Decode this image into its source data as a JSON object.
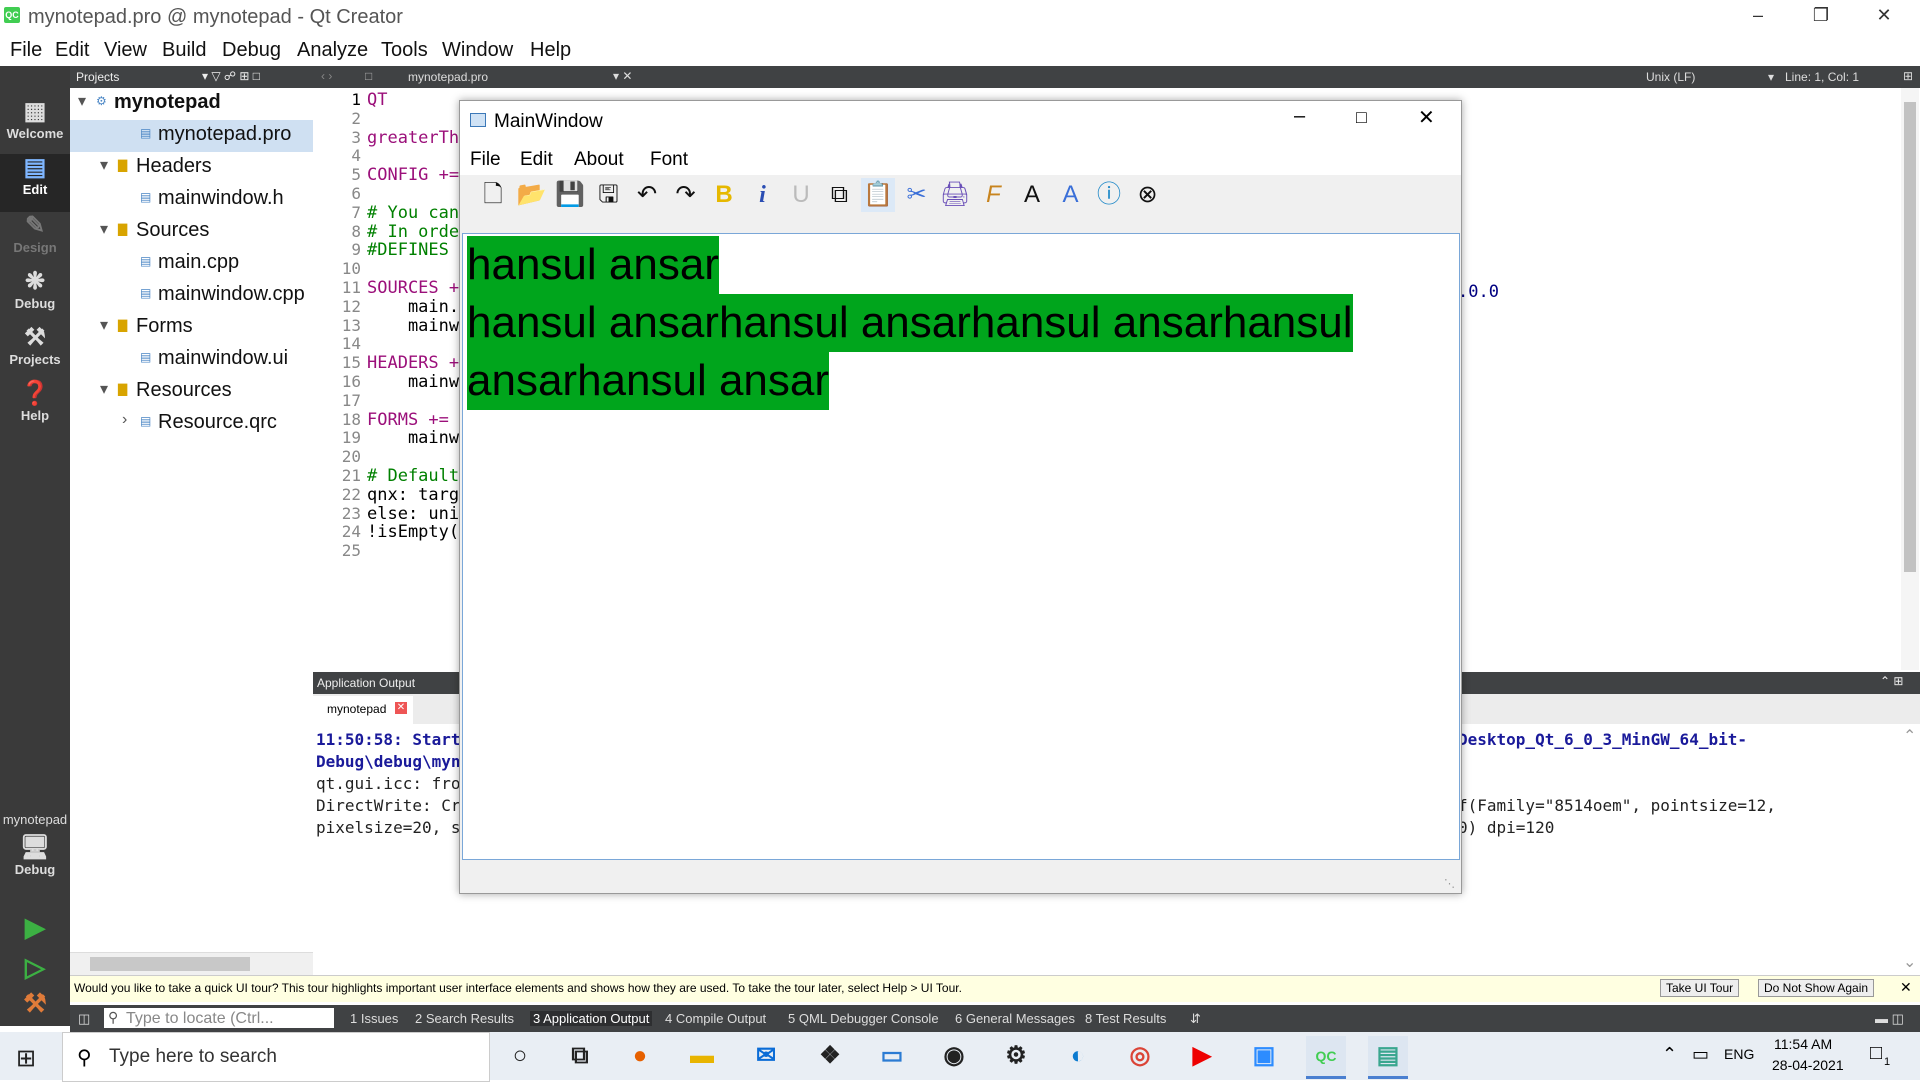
{
  "window": {
    "title": "mynotepad.pro @ mynotepad - Qt Creator",
    "logo": "QC"
  },
  "menubar": [
    "File",
    "Edit",
    "View",
    "Build",
    "Debug",
    "Analyze",
    "Tools",
    "Window",
    "Help"
  ],
  "modes": [
    {
      "icon": "grid-icon",
      "label": "Welcome"
    },
    {
      "icon": "edit-icon",
      "label": "Edit"
    },
    {
      "icon": "design-icon",
      "label": "Design"
    },
    {
      "icon": "bug-icon",
      "label": "Debug"
    },
    {
      "icon": "wrench-icon",
      "label": "Projects"
    },
    {
      "icon": "help-icon",
      "label": "Help"
    }
  ],
  "kit": {
    "project": "mynotepad",
    "config": "Debug"
  },
  "projects_header": "Projects",
  "tree": [
    {
      "label": "mynotepad",
      "indent": 0,
      "bold": true,
      "arrow": "▾"
    },
    {
      "label": "mynotepad.pro",
      "indent": 2,
      "selected": true
    },
    {
      "label": "Headers",
      "indent": 1,
      "arrow": "▾"
    },
    {
      "label": "mainwindow.h",
      "indent": 2
    },
    {
      "label": "Sources",
      "indent": 1,
      "arrow": "▾"
    },
    {
      "label": "main.cpp",
      "indent": 2
    },
    {
      "label": "mainwindow.cpp",
      "indent": 2
    },
    {
      "label": "Forms",
      "indent": 1,
      "arrow": "▾"
    },
    {
      "label": "mainwindow.ui",
      "indent": 2
    },
    {
      "label": "Resources",
      "indent": 1,
      "arrow": "▾"
    },
    {
      "label": "Resource.qrc",
      "indent": 2,
      "arrow": "›"
    }
  ],
  "editor": {
    "file_tab": "mynotepad.pro",
    "line_ending": "Unix (LF)",
    "position": "Line: 1, Col: 1",
    "right_fragment": ".0.0",
    "lines": [
      {
        "n": "1",
        "t": "QT",
        "c": "kw"
      },
      {
        "n": "2",
        "t": "",
        "c": ""
      },
      {
        "n": "3",
        "t": "greaterTh",
        "c": "kw"
      },
      {
        "n": "4",
        "t": "",
        "c": ""
      },
      {
        "n": "5",
        "t": "CONFIG +=",
        "c": "kw"
      },
      {
        "n": "6",
        "t": "",
        "c": ""
      },
      {
        "n": "7",
        "t": "# You can",
        "c": "cm"
      },
      {
        "n": "8",
        "t": "# In orde",
        "c": "cm"
      },
      {
        "n": "9",
        "t": "#DEFINES",
        "c": "cm"
      },
      {
        "n": "10",
        "t": "",
        "c": ""
      },
      {
        "n": "11",
        "t": "SOURCES +",
        "c": "kw"
      },
      {
        "n": "12",
        "t": "    main.",
        "c": ""
      },
      {
        "n": "13",
        "t": "    mainw",
        "c": ""
      },
      {
        "n": "14",
        "t": "",
        "c": ""
      },
      {
        "n": "15",
        "t": "HEADERS +",
        "c": "kw"
      },
      {
        "n": "16",
        "t": "    mainw",
        "c": ""
      },
      {
        "n": "17",
        "t": "",
        "c": ""
      },
      {
        "n": "18",
        "t": "FORMS +=",
        "c": "kw"
      },
      {
        "n": "19",
        "t": "    mainw",
        "c": ""
      },
      {
        "n": "20",
        "t": "",
        "c": ""
      },
      {
        "n": "21",
        "t": "# Default",
        "c": "cm"
      },
      {
        "n": "22",
        "t": "qnx: targ",
        "c": ""
      },
      {
        "n": "23",
        "t": "else: uni",
        "c": ""
      },
      {
        "n": "24",
        "t": "!isEmpty(",
        "c": ""
      },
      {
        "n": "25",
        "t": "",
        "c": ""
      }
    ]
  },
  "output": {
    "header": "Application Output",
    "tab": "mynotepad",
    "left_lines": [
      "11:50:58: Start",
      "Debug\\debug\\myn",
      "qt.gui.icc: fro",
      "DirectWrite: Cr",
      "pixelsize=20, s"
    ],
    "right_lines": [
      "Desktop_Qt_6_0_3_MinGW_64_bit-",
      "",
      "",
      "f(Family=\"8514oem\", pointsize=12,",
      "0) dpi=120"
    ]
  },
  "tour": {
    "text": "Would you like to take a quick UI tour? This tour highlights important user interface elements and shows how they are used. To take the tour later, select Help > UI Tour.",
    "take": "Take UI Tour",
    "dismiss": "Do Not Show Again"
  },
  "statusbar": {
    "locator_placeholder": "Type to locate (Ctrl...",
    "tabs": [
      "1  Issues",
      "2  Search Results",
      "3  Application Output",
      "4  Compile Output",
      "5  QML Debugger Console",
      "6  General Messages",
      "8  Test Results"
    ]
  },
  "mainwindow": {
    "title": "MainWindow",
    "menus": [
      "File",
      "Edit",
      "About",
      "Font"
    ],
    "tools": [
      "new-file-icon",
      "open-folder-icon",
      "save-icon",
      "save-as-icon",
      "undo-icon",
      "redo-icon",
      "bold-icon",
      "italic-icon",
      "underline-icon",
      "copy-icon",
      "paste-icon",
      "cut-icon",
      "print-icon",
      "font-icon",
      "font-color-icon",
      "highlight-icon",
      "about-icon",
      "close-circle-icon"
    ],
    "text_lines": [
      "hansul ansar",
      "hansul ansarhansul ansarhansul ansarhansul",
      "ansarhansul ansar"
    ],
    "highlight_color": "#00a51c"
  },
  "taskbar": {
    "search_placeholder": "Type here to search",
    "lang": "ENG",
    "time": "11:54 AM",
    "date": "28-04-2021",
    "notif": "1",
    "apps": [
      "cortana-icon",
      "task-view-icon",
      "firefox-icon",
      "file-explorer-icon",
      "mail-icon",
      "dropbox-icon",
      "devices-icon",
      "camera-icon",
      "settings-icon",
      "edge-icon",
      "chrome-icon",
      "youtube-icon",
      "zoom-icon",
      "qt-creator-icon",
      "notepad-app-icon"
    ]
  }
}
